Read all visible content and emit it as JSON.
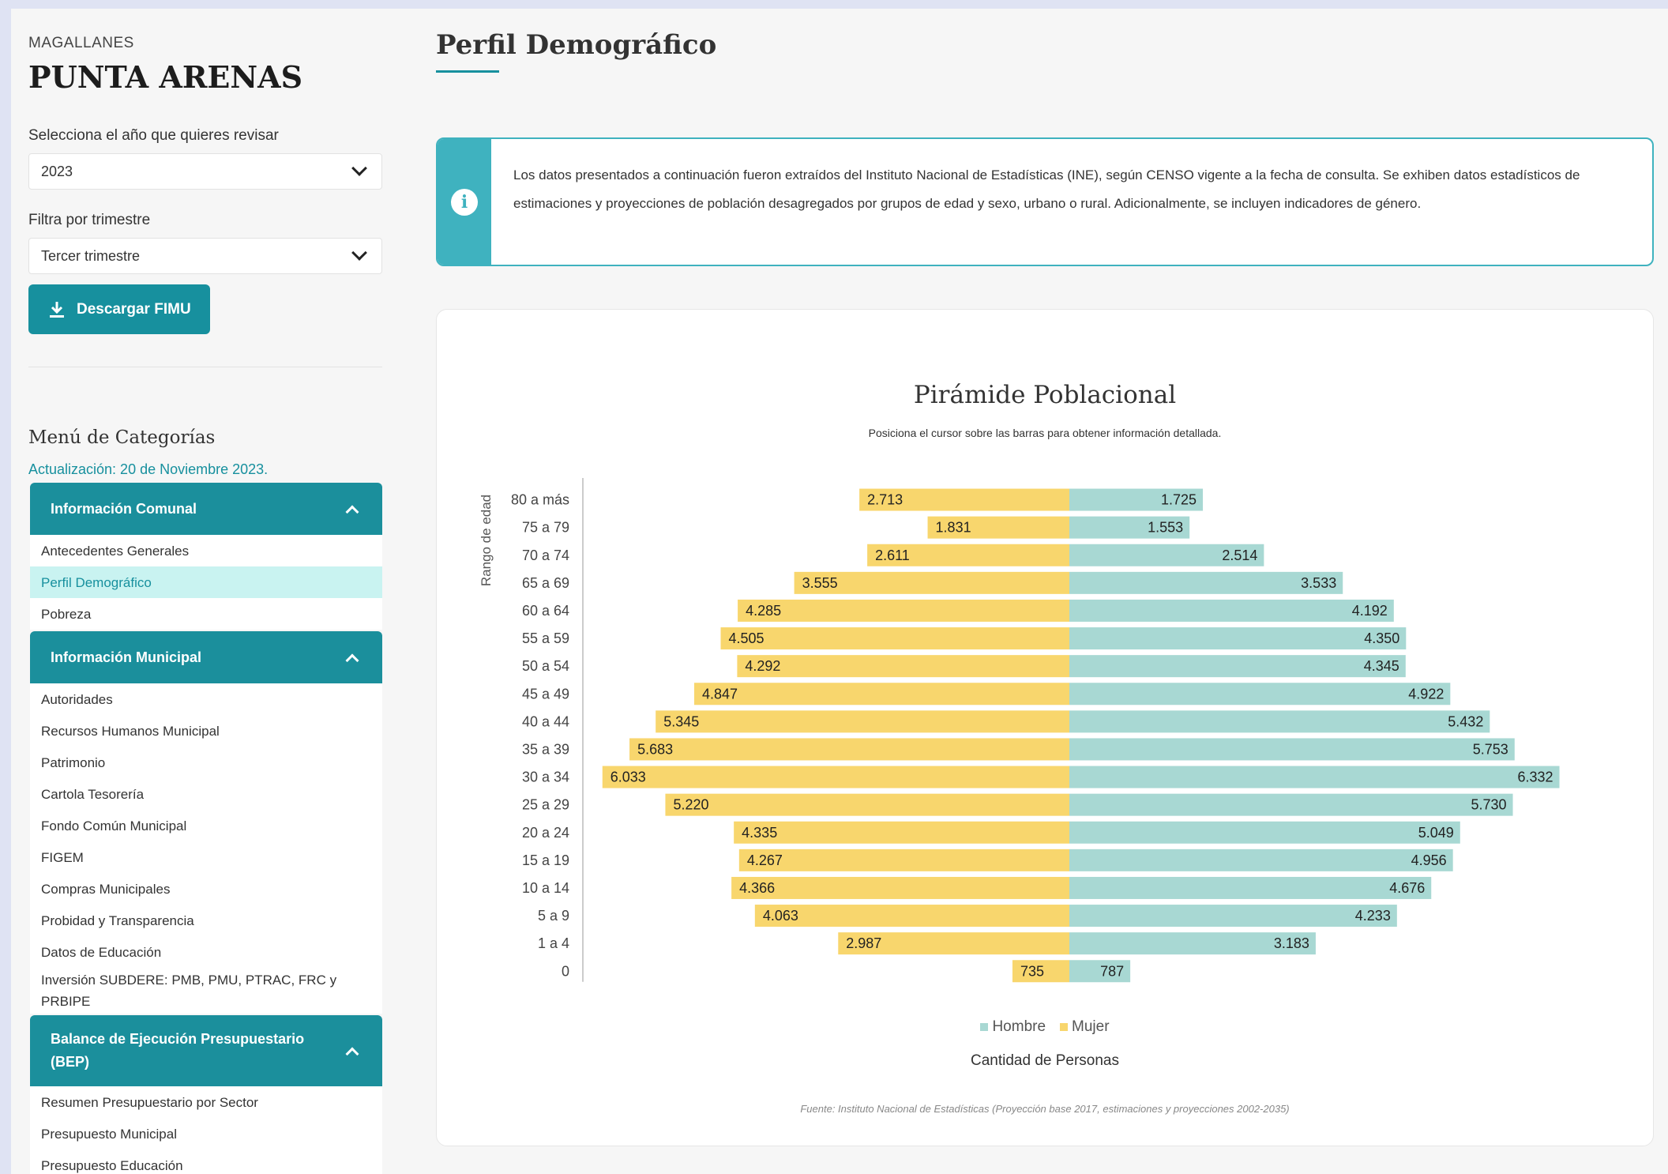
{
  "sidebar": {
    "region": "MAGALLANES",
    "comuna": "PUNTA ARENAS",
    "year_label": "Selecciona el año que quieres revisar",
    "year_value": "2023",
    "quarter_label": "Filtra por trimestre",
    "quarter_value": "Tercer trimestre",
    "download_label": "Descargar FIMU",
    "menu_title": "Menú de Categorías",
    "update_text": "Actualización: 20 de Noviembre 2023.",
    "sections": [
      {
        "title": "Información Comunal",
        "items": [
          "Antecedentes Generales",
          "Perfil Demográfico",
          "Pobreza"
        ]
      },
      {
        "title": "Información Municipal",
        "items": [
          "Autoridades",
          "Recursos Humanos Municipal",
          "Patrimonio",
          "Cartola Tesorería",
          "Fondo Común Municipal",
          "FIGEM",
          "Compras Municipales",
          "Probidad y Transparencia",
          "Datos de Educación",
          "Inversión SUBDERE: PMB, PMU, PTRAC, FRC y PRBIPE"
        ]
      },
      {
        "title": "Balance de Ejecución Presupuestario (BEP)",
        "items": [
          "Resumen Presupuestario por Sector",
          "Presupuesto Municipal",
          "Presupuesto Educación"
        ]
      }
    ],
    "active_item": "Perfil Demográfico"
  },
  "main": {
    "title": "Perfil Demográfico",
    "info_text": "Los datos presentados a continuación fueron extraídos del Instituto Nacional de Estadísticas (INE), según CENSO vigente a la fecha de consulta. Se exhiben datos estadísticos de estimaciones y proyecciones de población desagregados por grupos de edad y sexo, urbano o rural. Adicionalmente, se incluyen indicadores de género."
  },
  "colors": {
    "accent": "#17909e",
    "hombre": "#a8d8d3",
    "mujer": "#f8d66d"
  },
  "chart_data": {
    "type": "bar",
    "orientation": "horizontal-pyramid",
    "title": "Pirámide Poblacional",
    "subtitle": "Posiciona el cursor sobre las barras para obtener información detallada.",
    "ylabel": "Rango de edad",
    "xlabel": "Cantidad de Personas",
    "source": "Fuente: Instituto Nacional de Estadísticas (Proyección base 2017, estimaciones y proyecciones 2002-2035)",
    "categories": [
      "80 a más",
      "75 a 79",
      "70 a 74",
      "65 a 69",
      "60 a 64",
      "55 a 59",
      "50 a 54",
      "45 a 49",
      "40 a 44",
      "35 a 39",
      "30 a 34",
      "25 a 29",
      "20 a 24",
      "15 a 19",
      "10 a 14",
      "5 a 9",
      "1 a 4",
      "0"
    ],
    "series": [
      {
        "name": "Hombre",
        "values": [
          1725,
          1553,
          2514,
          3533,
          4192,
          4350,
          4345,
          4922,
          5432,
          5753,
          6332,
          5730,
          5049,
          4956,
          4676,
          4233,
          3183,
          787
        ]
      },
      {
        "name": "Mujer",
        "values": [
          2713,
          1831,
          2611,
          3555,
          4285,
          4505,
          4292,
          4847,
          5345,
          5683,
          6033,
          5220,
          4335,
          4267,
          4366,
          4063,
          2987,
          735
        ]
      }
    ],
    "value_labels": {
      "Hombre": [
        "1.725",
        "1.553",
        "2.514",
        "3.533",
        "4.192",
        "4.350",
        "4.345",
        "4.922",
        "5.432",
        "5.753",
        "6.332",
        "5.730",
        "5.049",
        "4.956",
        "4.676",
        "4.233",
        "3.183",
        "787"
      ],
      "Mujer": [
        "2.713",
        "1.831",
        "2.611",
        "3.555",
        "4.285",
        "4.505",
        "4.292",
        "4.847",
        "5.345",
        "5.683",
        "6.033",
        "5.220",
        "4.335",
        "4.267",
        "4.366",
        "4.063",
        "2.987",
        "735"
      ]
    },
    "legend_position": "bottom",
    "grid": false
  }
}
